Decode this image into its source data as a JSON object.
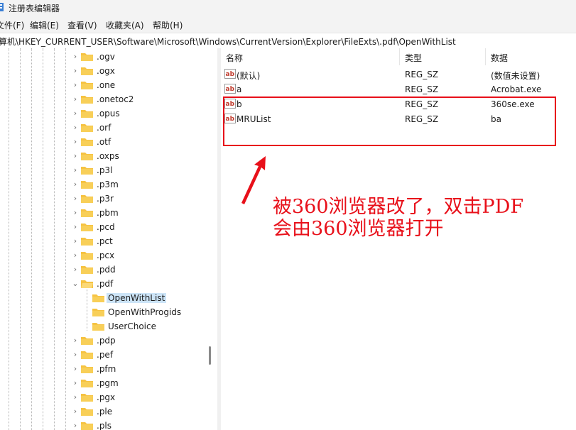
{
  "window": {
    "title": "注册表编辑器"
  },
  "menu": [
    {
      "label": "文件(F)"
    },
    {
      "label": "编辑(E)"
    },
    {
      "label": "查看(V)"
    },
    {
      "label": "收藏夹(A)"
    },
    {
      "label": "帮助(H)"
    }
  ],
  "address": {
    "path": "算机\\HKEY_CURRENT_USER\\Software\\Microsoft\\Windows\\CurrentVersion\\Explorer\\FileExts\\.pdf\\OpenWithList"
  },
  "tree": {
    "items": [
      {
        "label": ".ogv",
        "chevron": "›"
      },
      {
        "label": ".ogx",
        "chevron": "›"
      },
      {
        "label": ".one",
        "chevron": "›"
      },
      {
        "label": ".onetoc2",
        "chevron": "›"
      },
      {
        "label": ".opus",
        "chevron": "›"
      },
      {
        "label": ".orf",
        "chevron": "›"
      },
      {
        "label": ".otf",
        "chevron": "›"
      },
      {
        "label": ".oxps",
        "chevron": "›"
      },
      {
        "label": ".p3l",
        "chevron": "›"
      },
      {
        "label": ".p3m",
        "chevron": "›"
      },
      {
        "label": ".p3r",
        "chevron": "›"
      },
      {
        "label": ".pbm",
        "chevron": "›"
      },
      {
        "label": ".pcd",
        "chevron": "›"
      },
      {
        "label": ".pct",
        "chevron": "›"
      },
      {
        "label": ".pcx",
        "chevron": "›"
      },
      {
        "label": ".pdd",
        "chevron": "›"
      },
      {
        "label": ".pdf",
        "chevron": "⌄"
      },
      {
        "label": "OpenWithList",
        "selected": true
      },
      {
        "label": "OpenWithProgids"
      },
      {
        "label": "UserChoice"
      },
      {
        "label": ".pdp",
        "chevron": "›"
      },
      {
        "label": ".pef",
        "chevron": "›"
      },
      {
        "label": ".pfm",
        "chevron": "›"
      },
      {
        "label": ".pgm",
        "chevron": "›"
      },
      {
        "label": ".pgx",
        "chevron": "›"
      },
      {
        "label": ".ple",
        "chevron": "›"
      },
      {
        "label": ".pls",
        "chevron": "›"
      }
    ]
  },
  "values": {
    "columns": {
      "name": "名称",
      "type": "类型",
      "data": "数据"
    },
    "rows": [
      {
        "name": "(默认)",
        "type": "REG_SZ",
        "data": "(数值未设置)",
        "icon": "reg-string-icon"
      },
      {
        "name": "a",
        "type": "REG_SZ",
        "data": "Acrobat.exe",
        "icon": "reg-string-icon"
      },
      {
        "name": "b",
        "type": "REG_SZ",
        "data": "360se.exe",
        "icon": "reg-string-icon"
      },
      {
        "name": "MRUList",
        "type": "REG_SZ",
        "data": "ba",
        "icon": "reg-string-icon"
      }
    ]
  },
  "annotation": {
    "line1": "被360浏览器改了，双击PDF",
    "line2": "会由360浏览器打开",
    "color": "#e8101a"
  },
  "colors": {
    "chrome_bg": "#f3f3f3",
    "selection": "#cce4f7",
    "folder": "#f6c342",
    "accent_red": "#e8101a"
  }
}
